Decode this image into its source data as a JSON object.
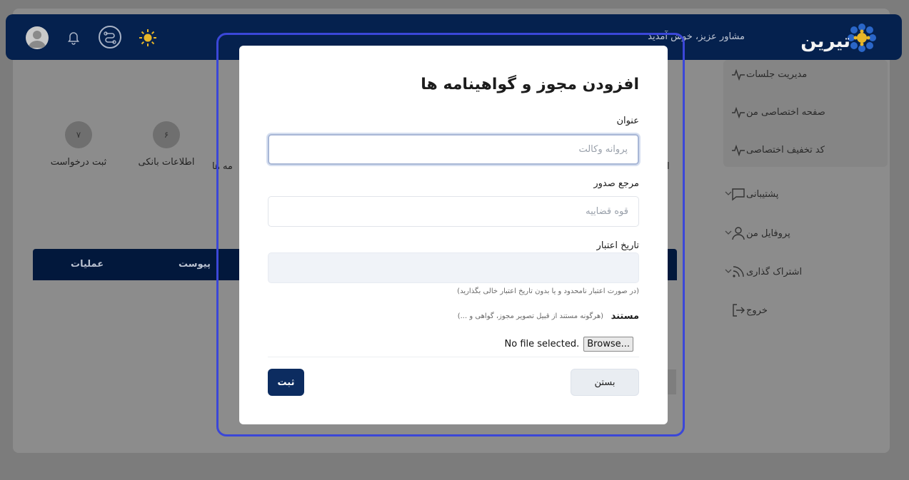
{
  "header": {
    "brand": "تیرین",
    "greeting": "مشاور عزیز، خوش آمدید"
  },
  "sidebar": {
    "items": [
      {
        "label": "مدیریت جلسات"
      },
      {
        "label": "صفحه اختصاصی من"
      },
      {
        "label": "کد تخفیف اختصاصی"
      },
      {
        "label": "پشتیبانی"
      },
      {
        "label": "پروفایل من"
      },
      {
        "label": "اشتراک گذاری"
      },
      {
        "label": "خروج"
      }
    ]
  },
  "steps": [
    {
      "num": "۷",
      "label": "ثبت درخواست"
    },
    {
      "num": "۶",
      "label": "اطلاعات بانکی"
    }
  ],
  "steps_partial": {
    "left_cut": "مه ها",
    "right_cut": "ا"
  },
  "table": {
    "columns": [
      "عملیات",
      "پیوست"
    ]
  },
  "modal": {
    "title": "افزودن مجوز و گواهینامه ها",
    "title_field": {
      "label": "عنوان",
      "placeholder": "پروانه وکالت"
    },
    "issuer_field": {
      "label": "مرجع صدور",
      "placeholder": "قوه قضاییه"
    },
    "validity_field": {
      "label": "تاریخ اعتبار",
      "hint": "(در صورت اعتبار نامحدود و یا بدون تاریخ اعتبار خالی بگذارید)"
    },
    "document": {
      "label": "مستند",
      "hint": "(هرگونه مستند از قبیل تصویر مجوز، گواهی و ...)",
      "browse_label": "Browse...",
      "file_status": "No file selected."
    },
    "close_label": "بستن",
    "submit_label": "ثبت"
  }
}
